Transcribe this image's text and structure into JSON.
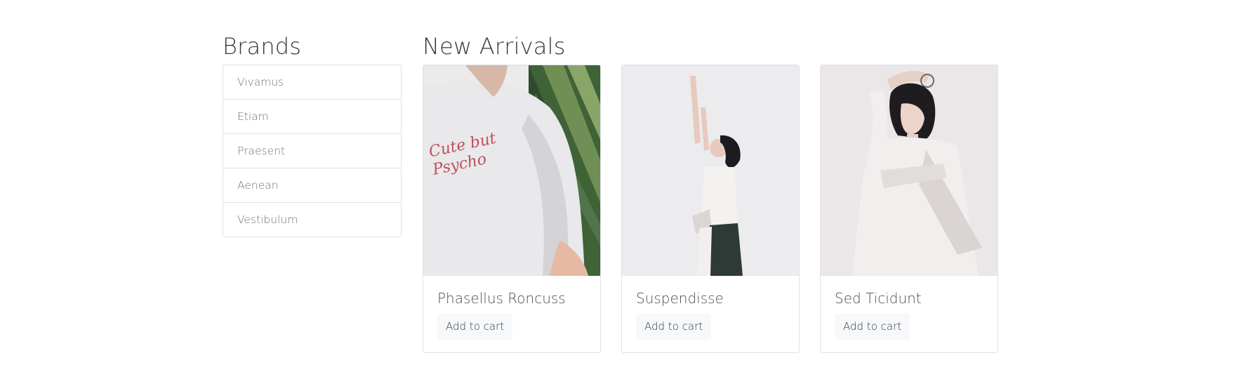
{
  "brands": {
    "title": "Brands",
    "items": [
      {
        "label": "Vivamus"
      },
      {
        "label": "Etiam"
      },
      {
        "label": "Praesent"
      },
      {
        "label": "Aenean"
      },
      {
        "label": "Vestibulum"
      }
    ]
  },
  "arrivals": {
    "title": "New Arrivals",
    "products": [
      {
        "name": "Phasellus Roncuss",
        "button_label": "Add to cart",
        "image_caption": "Cute but Psycho"
      },
      {
        "name": "Suspendisse",
        "button_label": "Add to cart"
      },
      {
        "name": "Sed Ticidunt",
        "button_label": "Add to cart"
      }
    ]
  },
  "colors": {
    "border": "#dee2e6",
    "text_dark": "#343a40",
    "text_muted": "#6c757d",
    "button_bg": "#f7f8f9",
    "embroidery": "#c0505a"
  }
}
